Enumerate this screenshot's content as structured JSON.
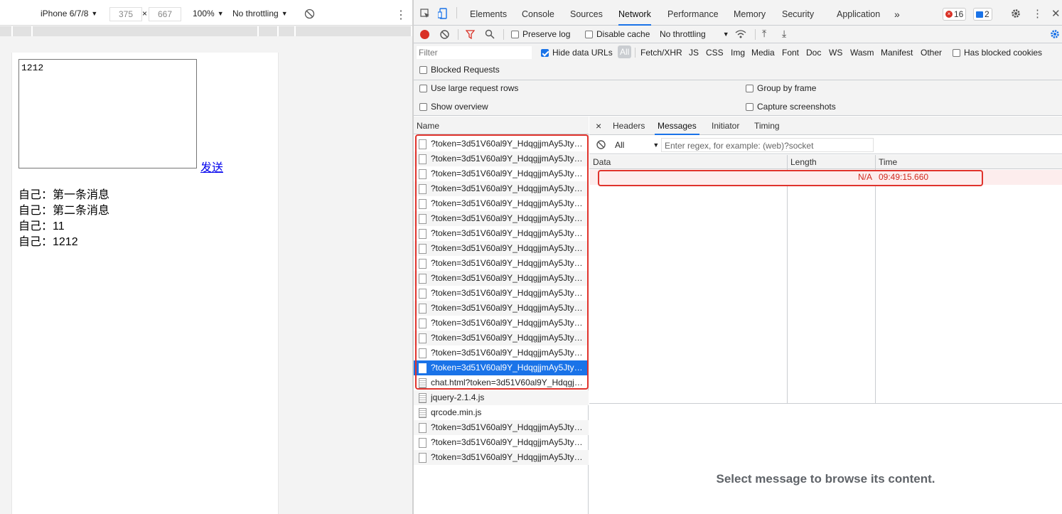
{
  "device_toolbar": {
    "device": "iPhone 6/7/8",
    "width": "375",
    "times": "×",
    "height": "667",
    "zoom": "100%",
    "throttle": "No throttling"
  },
  "page": {
    "textarea_value": "1212",
    "send_link": "发送",
    "messages": [
      "自己：第一条消息",
      "自己：第二条消息",
      "自己：11",
      "自己：1212"
    ]
  },
  "devtools": {
    "tabs": [
      "Elements",
      "Console",
      "Sources",
      "Network",
      "Performance",
      "Memory",
      "Security",
      "Application"
    ],
    "more": "»",
    "error_count": "16",
    "info_count": "2",
    "toolbar": {
      "preserve_log": "Preserve log",
      "disable_cache": "Disable cache",
      "throttle": "No throttling"
    },
    "filter": {
      "placeholder": "Filter",
      "hide_data_urls": "Hide data URLs",
      "types": [
        "All",
        "Fetch/XHR",
        "JS",
        "CSS",
        "Img",
        "Media",
        "Font",
        "Doc",
        "WS",
        "Wasm",
        "Manifest",
        "Other"
      ],
      "has_blocked_cookies": "Has blocked cookies",
      "blocked_requests": "Blocked Requests"
    },
    "options": {
      "large_rows": "Use large request rows",
      "group_by_frame": "Group by frame",
      "show_overview": "Show overview",
      "capture_screenshots": "Capture screenshots"
    },
    "name_header": "Name",
    "requests": [
      "?token=3d51V60al9Y_HdqgjjmAy5JtyKZiUOL5",
      "?token=3d51V60al9Y_HdqgjjmAy5JtyKZiUOL5",
      "?token=3d51V60al9Y_HdqgjjmAy5JtyKZiUOL5",
      "?token=3d51V60al9Y_HdqgjjmAy5JtyKZiUOL5",
      "?token=3d51V60al9Y_HdqgjjmAy5JtyKZiUOL5",
      "?token=3d51V60al9Y_HdqgjjmAy5JtyKZiUOL5",
      "?token=3d51V60al9Y_HdqgjjmAy5JtyKZiUOL5",
      "?token=3d51V60al9Y_HdqgjjmAy5JtyKZiUOL5",
      "?token=3d51V60al9Y_HdqgjjmAy5JtyKZiUOL5",
      "?token=3d51V60al9Y_HdqgjjmAy5JtyKZiUOL5",
      "?token=3d51V60al9Y_HdqgjjmAy5JtyKZiUOL5",
      "?token=3d51V60al9Y_HdqgjjmAy5JtyKZiUOL5",
      "?token=3d51V60al9Y_HdqgjjmAy5JtyKZiUOL5",
      "?token=3d51V60al9Y_HdqgjjmAy5JtyKZiUOL5",
      "?token=3d51V60al9Y_HdqgjjmAy5JtyKZiUOL5",
      "?token=3d51V60al9Y_HdqgjjmAy5JtyKZiUOL5",
      "chat.html?token=3d51V60al9Y_HdqgjjmAy5JtyKZiUOL5",
      "jquery-2.1.4.js",
      "qrcode.min.js",
      "?token=3d51V60al9Y_HdqgjjmAy5JtyKZiUOL5",
      "?token=3d51V60al9Y_HdqgjjmAy5JtyKZiUOL5",
      "?token=3d51V60al9Y_HdqgjjmAy5JtyKZiUOL5"
    ],
    "detail_tabs": [
      "Headers",
      "Messages",
      "Initiator",
      "Timing"
    ],
    "close": "×",
    "message_filter": {
      "select": "All",
      "regex_placeholder": "Enter regex, for example: (web)?socket"
    },
    "message_columns": [
      "Data",
      "Length",
      "Time"
    ],
    "message_row": {
      "data": "",
      "length": "N/A",
      "time": "09:49:15.660"
    },
    "empty_text": "Select message to browse its content."
  }
}
